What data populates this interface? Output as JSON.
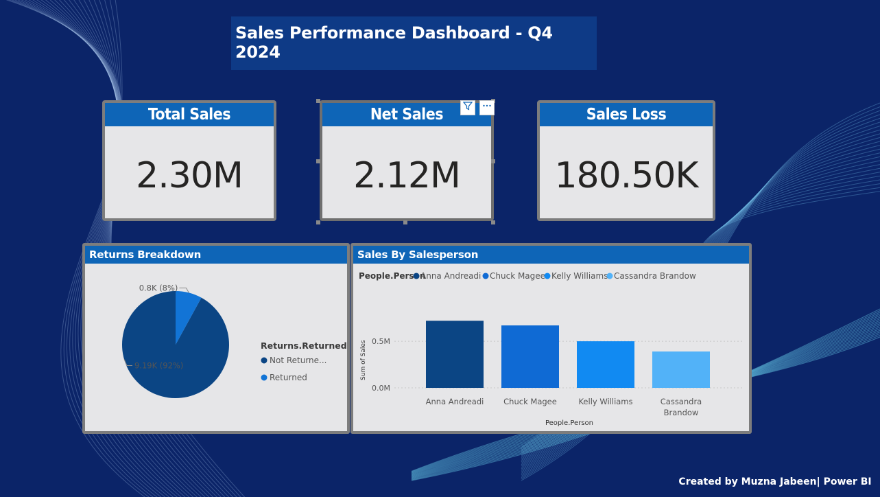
{
  "dashboard": {
    "title": "Sales Performance Dashboard - Q4 2024",
    "footer": "Created by Muzna Jabeen| Power BI"
  },
  "kpis": [
    {
      "label": "Total Sales",
      "value": "2.30M"
    },
    {
      "label": "Net Sales",
      "value": "2.12M"
    },
    {
      "label": "Sales Loss",
      "value": "180.50K"
    }
  ],
  "visual_header_icons": [
    "filter-icon",
    "more-options-icon"
  ],
  "returns_panel": {
    "title": "Returns Breakdown",
    "legend_title": "Returns.Returned",
    "slice_labels": [
      "9.19K (92%)",
      "0.8K (8%)"
    ]
  },
  "sales_panel": {
    "title": "Sales By Salesperson",
    "legend_title": "People.Person",
    "y_axis_title": "Sum of Sales",
    "x_axis_title": "People.Person",
    "y_ticks": [
      "0.0M",
      "0.5M"
    ]
  },
  "colors": {
    "background": "#0b2468",
    "header_blue": "#0e65b7",
    "card_bg": "#e6e6e8",
    "anna": "#0b4584",
    "chuck": "#0f6ad4",
    "kelly": "#118af2",
    "cassandra": "#52b2f8",
    "returned": "#1274d6",
    "not_returned": "#0b4584"
  },
  "chart_data": [
    {
      "type": "pie",
      "legend_title": "Returns.Returned",
      "categories": [
        "Not Returne...",
        "Returned"
      ],
      "values": [
        9190,
        800
      ],
      "data_labels": [
        "9.19K (92%)",
        "0.8K (8%)"
      ]
    },
    {
      "type": "bar",
      "legend_title": "People.Person",
      "categories": [
        "Anna Andreadi",
        "Chuck Magee",
        "Kelly Williams",
        "Cassandra Brandow"
      ],
      "values": [
        0.72,
        0.67,
        0.5,
        0.39
      ],
      "ylabel": "Sum of Sales",
      "xlabel": "People.Person",
      "y_ticks": [
        "0.0M",
        "0.5M"
      ],
      "ylim": [
        0,
        0.8
      ],
      "grid": true,
      "legend_position": "top-left"
    }
  ]
}
